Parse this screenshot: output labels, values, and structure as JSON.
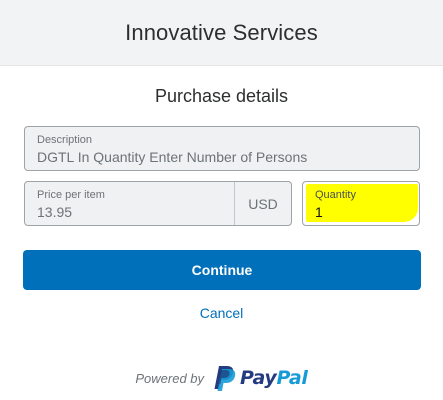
{
  "header": {
    "merchant_name": "Innovative Services"
  },
  "main": {
    "title": "Purchase details",
    "description": {
      "label": "Description",
      "value": "DGTL In Quantity Enter Number of Persons"
    },
    "price": {
      "label": "Price per item",
      "value": "13.95",
      "currency": "USD"
    },
    "quantity": {
      "label": "Quantity",
      "value": "1",
      "highlight_color": "#ffff00"
    },
    "continue_label": "Continue",
    "cancel_label": "Cancel"
  },
  "footer": {
    "powered_by": "Powered by",
    "brand_pay": "Pay",
    "brand_pal": "Pal",
    "brand_colors": {
      "pay": "#253b80",
      "pal": "#179bd7"
    }
  },
  "colors": {
    "accent": "#0070ba",
    "header_bg": "#f2f3f4"
  }
}
